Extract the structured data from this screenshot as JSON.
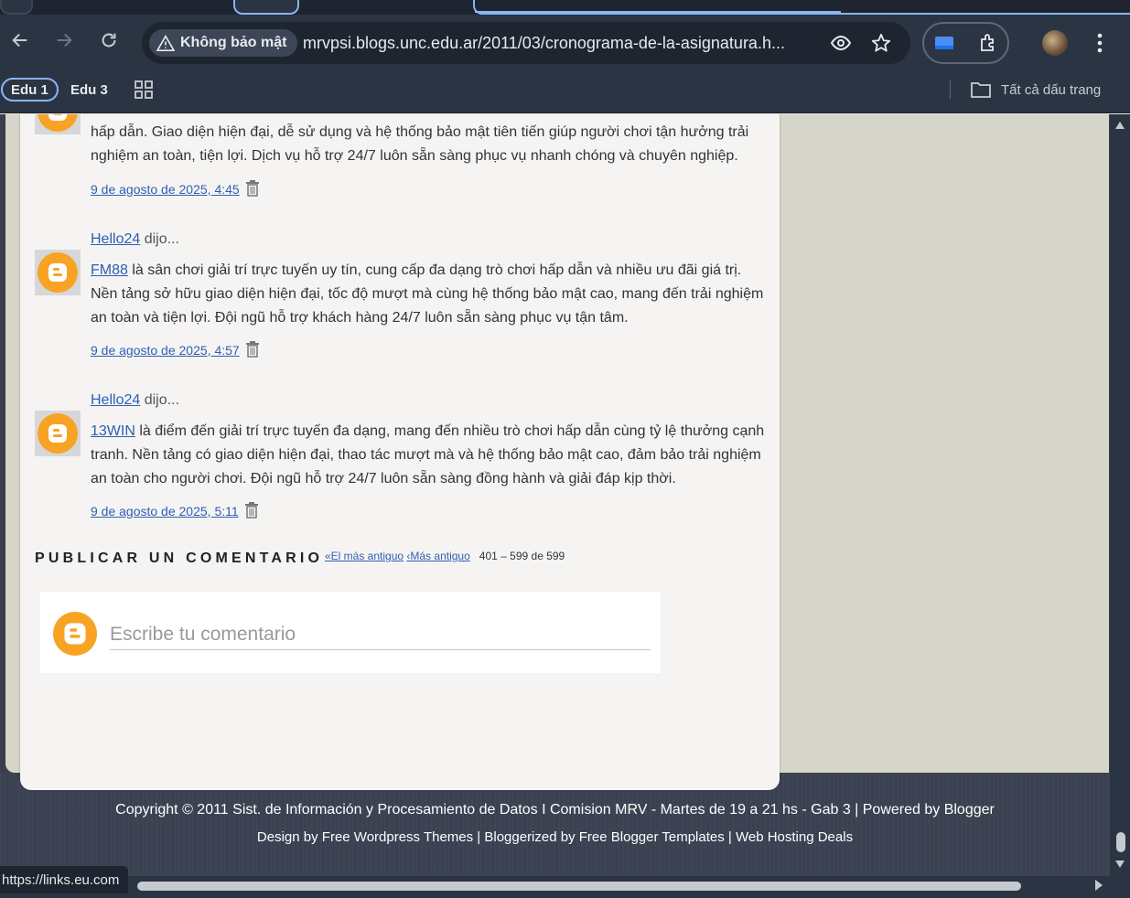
{
  "browser": {
    "security_label": "Không bảo mật",
    "url": "mrvpsi.blogs.unc.edu.ar/2011/03/cronograma-de-la-asignatura.h...",
    "bookmarks": [
      "Edu 1",
      "Edu 3"
    ],
    "all_bookmarks_label": "Tất cả dấu trang",
    "status_url": "https://links.eu.com",
    "accent_color": "#8ab4f8"
  },
  "comments": [
    {
      "author": "",
      "said": "",
      "line_partial": "hấp dẫn. Giao diện hiện đại, dễ sử dụng và hệ thống bảo mật tiên tiến giúp người chơi tận hưởng trải nghiệm an toàn, tiện lợi. Dịch vụ hỗ trợ 24/7 luôn sẵn sàng phục vụ nhanh chóng và chuyên nghiệp.",
      "timestamp": "9 de agosto de 2025, 4:45"
    },
    {
      "author": "Hello24",
      "said": " dijo...",
      "link": "FM88",
      "text": " là sân chơi giải trí trực tuyến uy tín, cung cấp đa dạng trò chơi hấp dẫn và nhiều ưu đãi giá trị. Nền tảng sở hữu giao diện hiện đại, tốc độ mượt mà cùng hệ thống bảo mật cao, mang đến trải nghiệm an toàn và tiện lợi. Đội ngũ hỗ trợ khách hàng 24/7 luôn sẵn sàng phục vụ tận tâm.",
      "timestamp": "9 de agosto de 2025, 4:57"
    },
    {
      "author": "Hello24",
      "said": " dijo...",
      "link": "13WIN",
      "text": " là điểm đến giải trí trực tuyến đa dạng, mang đến nhiều trò chơi hấp dẫn cùng tỷ lệ thưởng cạnh tranh. Nền tảng có giao diện hiện đại, thao tác mượt mà và hệ thống bảo mật cao, đảm bảo trải nghiệm an toàn cho người chơi. Đội ngũ hỗ trợ 24/7 luôn sẵn sàng đồng hành và giải đáp kịp thời.",
      "timestamp": "9 de agosto de 2025, 5:11"
    }
  ],
  "publish": {
    "heading": "PUBLICAR UN COMENTARIO",
    "oldest_link": "«El más antiguo",
    "older_link": "‹Más antiguo",
    "range": "401 – 599 de 599",
    "placeholder": "Escribe tu comentario"
  },
  "footer": {
    "line1": "Copyright © 2011 Sist. de Información y Procesamiento de Datos I Comision MRV - Martes de 19 a 21 hs - Gab 3 | Powered by Blogger",
    "line2": "Design by Free Wordpress Themes | Bloggerized by Free Blogger Templates | Web Hosting Deals"
  },
  "colors": {
    "link": "#2d5fb3",
    "blogger_orange": "#f8a323",
    "sidebar_panel": "#d6d5c9",
    "footer_bg": "#3a4150"
  }
}
